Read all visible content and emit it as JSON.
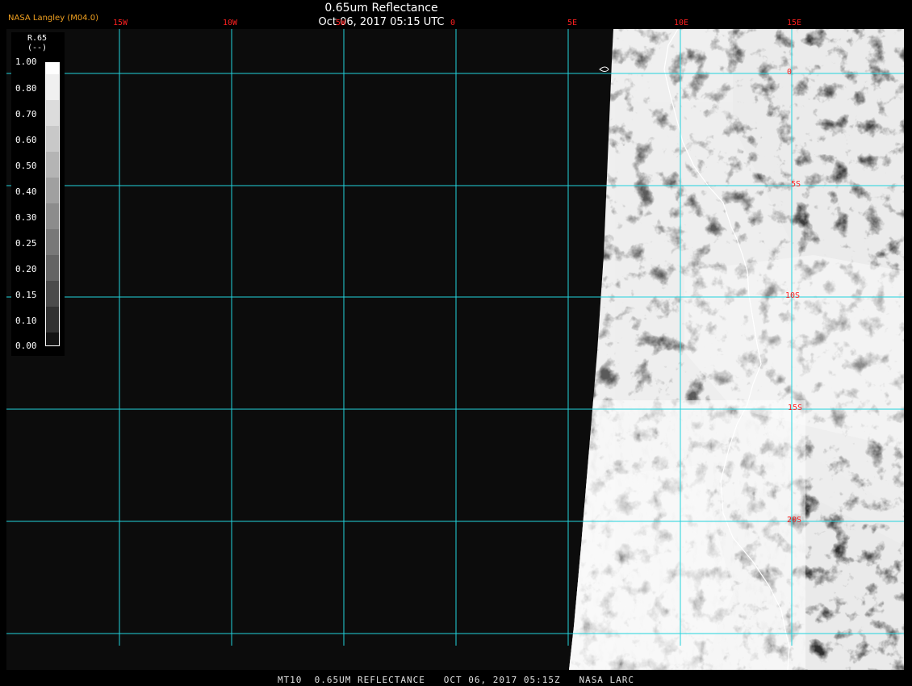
{
  "header": {
    "title": "0.65um Reflectance",
    "timestamp": "Oct 06, 2017 05:15 UTC",
    "brand": "NASA Langley (M04.0)"
  },
  "longitude_labels": [
    "15W",
    "10W",
    "5W",
    "0",
    "5E",
    "10E",
    "15E"
  ],
  "latitude_labels": [
    "0",
    "5S",
    "10S",
    "15S",
    "20S"
  ],
  "colorbar": {
    "title": "R.65",
    "units": "(--)",
    "ticks": [
      "1.00",
      "0.80",
      "0.70",
      "0.60",
      "0.50",
      "0.40",
      "0.30",
      "0.25",
      "0.20",
      "0.15",
      "0.10",
      "0.00"
    ]
  },
  "footer": {
    "text": "MT10  0.65UM REFLECTANCE   OCT 06, 2017 05:15Z   NASA LARC"
  },
  "colors": {
    "grid": "#22d3dd",
    "labels": "#ff2020",
    "brand": "#f0a020",
    "coastline": "#ffffff"
  }
}
